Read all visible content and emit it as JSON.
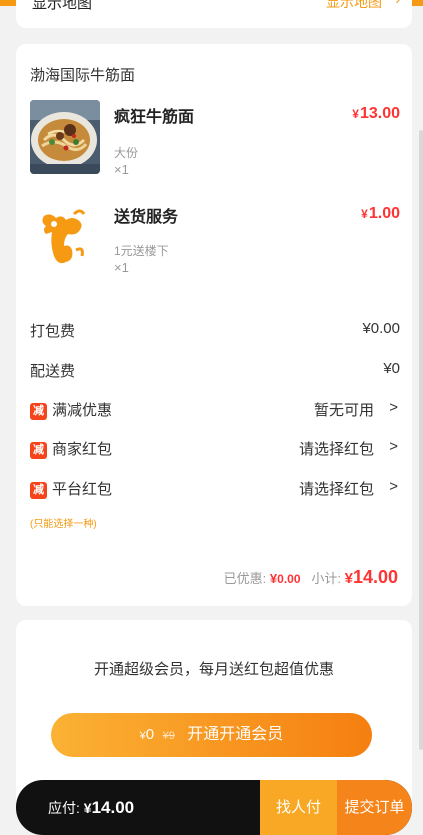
{
  "top_section": {
    "left_label": "显示地图",
    "right_label": "显示地图",
    "chevron": "chevron-right-icon"
  },
  "order": {
    "shop_name": "渤海国际牛筋面",
    "items": [
      {
        "name": "疯狂牛筋面",
        "spec": "大份",
        "qty": "×1",
        "price_symbol": "¥",
        "price": "13.00",
        "icon": "noodle-bowl-image"
      },
      {
        "name": "送货服务",
        "spec": "1元送楼下",
        "qty": "×1",
        "price_symbol": "¥",
        "price": "1.00",
        "icon": "delivery-mascot-logo"
      }
    ],
    "packing_fee": {
      "label": "打包费",
      "value": "¥0.00"
    },
    "delivery_fee": {
      "label": "配送费",
      "value": "¥0"
    },
    "discounts": [
      {
        "badge": "减",
        "label": "满减优惠",
        "value": "暂无可用"
      },
      {
        "badge": "减",
        "label": "商家红包",
        "value": "请选择红包"
      },
      {
        "badge": "减",
        "label": "平台红包",
        "value": "请选择红包"
      }
    ],
    "note": "(只能选择一种)",
    "summary": {
      "discount_label": "已优惠:",
      "discount_symbol": "¥",
      "discount_value": "0.00",
      "subtotal_label": "小计:",
      "subtotal_symbol": "¥",
      "subtotal_value": "14.00"
    }
  },
  "vip": {
    "promo_text": "开通超级会员，每月送红包超值优惠",
    "button_price_symbol": "¥",
    "button_price": "0",
    "button_orig_price": "¥9",
    "button_label": "开通开通会员"
  },
  "bottom_bar": {
    "pay_label": "应付:",
    "pay_symbol": "¥",
    "pay_value": "14.00",
    "find_button": "找人付",
    "submit_button": "提交订单"
  },
  "colors": {
    "accent": "#f59a12",
    "price_red": "#ff3333",
    "badge_red": "#f5431a",
    "dark_bar": "#111111"
  }
}
